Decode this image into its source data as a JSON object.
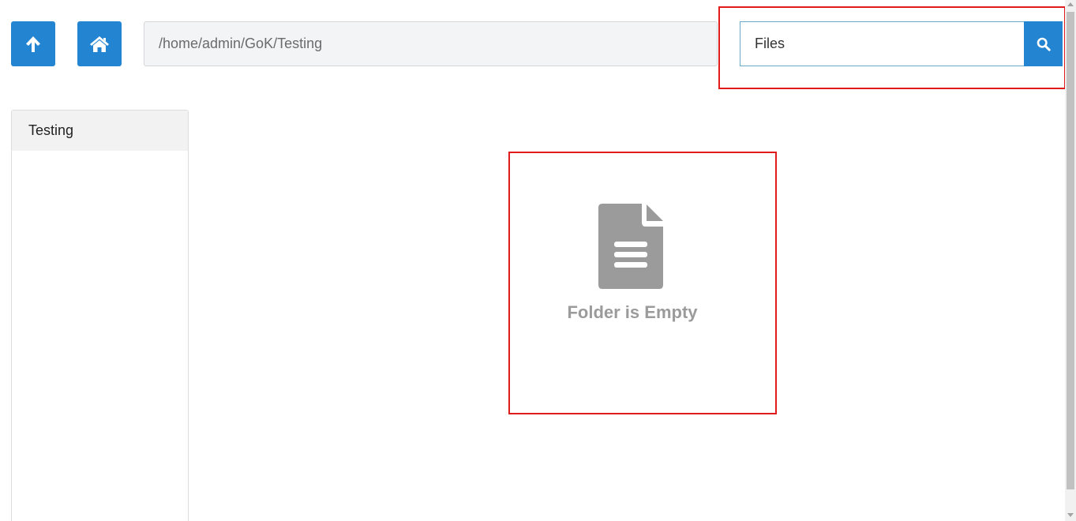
{
  "toolbar": {
    "up_icon": "arrow-up-icon",
    "home_icon": "home-icon",
    "path_value": "/home/admin/GoK/Testing"
  },
  "search": {
    "value": "Files",
    "icon": "search-icon"
  },
  "sidebar": {
    "items": [
      {
        "label": "Testing"
      }
    ]
  },
  "main": {
    "empty_icon": "document-icon",
    "empty_message": "Folder is Empty"
  },
  "colors": {
    "accent": "#2384d2",
    "highlight": "#e01b1b",
    "muted_text": "#9b9b9b"
  }
}
